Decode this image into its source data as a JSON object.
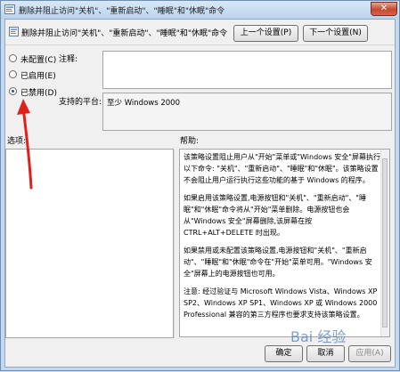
{
  "window": {
    "title": "删除并阻止访问\"关机\"、\"重新启动\"、\"睡眠\"和\"休眠\"命令",
    "close_label": "✕"
  },
  "policy": {
    "name": "删除并阻止访问\"关机\"、\"重新启动\"、\"睡眠\"和\"休眠\"命令",
    "prev_button": "上一个设置(P)",
    "next_button": "下一个设置(N)"
  },
  "options": {
    "not_configured": "未配置(C)",
    "enabled": "已启用(E)",
    "disabled": "已禁用(D)",
    "selected": "disabled"
  },
  "comment_label": "注释:",
  "comment_value": "",
  "supported_label": "支持的平台:",
  "supported_value": "至少 Windows 2000",
  "options_label": "选项:",
  "help_label": "帮助:",
  "help": {
    "p1": "该策略设置阻止用户从\"开始\"菜单或\"Windows 安全\"屏幕执行以下命令: \"关机\"、\"重新启动\"、\"睡眠\"和\"休眠\"。该策略设置不会阻止用户运行执行这些功能的基于 Windows 的程序。",
    "p2": "如果启用该策略设置,电源按钮和\"关机\"、\"重新启动\"、\"睡眠\"和\"休眠\"命令将从\"开始\"菜单删除。电源按钮也会从\"Windows 安全\"屏幕删除,该屏幕在按 CTRL+ALT+DELETE 时出现。",
    "p3": "如果禁用或未配置该策略设置,电源按钮和\"关机\"、\"重新启动\"、\"睡眠\"和\"休眠\"命令在\"开始\"菜单可用。\"Windows 安全\"屏幕上的电源按钮也可用。",
    "p4": "注意: 经过验证与 Microsoft Windows Vista、Windows XP SP2、Windows XP SP1、Windows XP 或 Windows 2000 Professional 兼容的第三方程序也要求支持该策略设置。"
  },
  "footer": {
    "ok": "确定",
    "cancel": "取消",
    "apply": "应用(A)"
  },
  "watermark": "Bai 经验",
  "colors": {
    "arrow": "#e0201a",
    "accent": "#1f5aa8"
  }
}
